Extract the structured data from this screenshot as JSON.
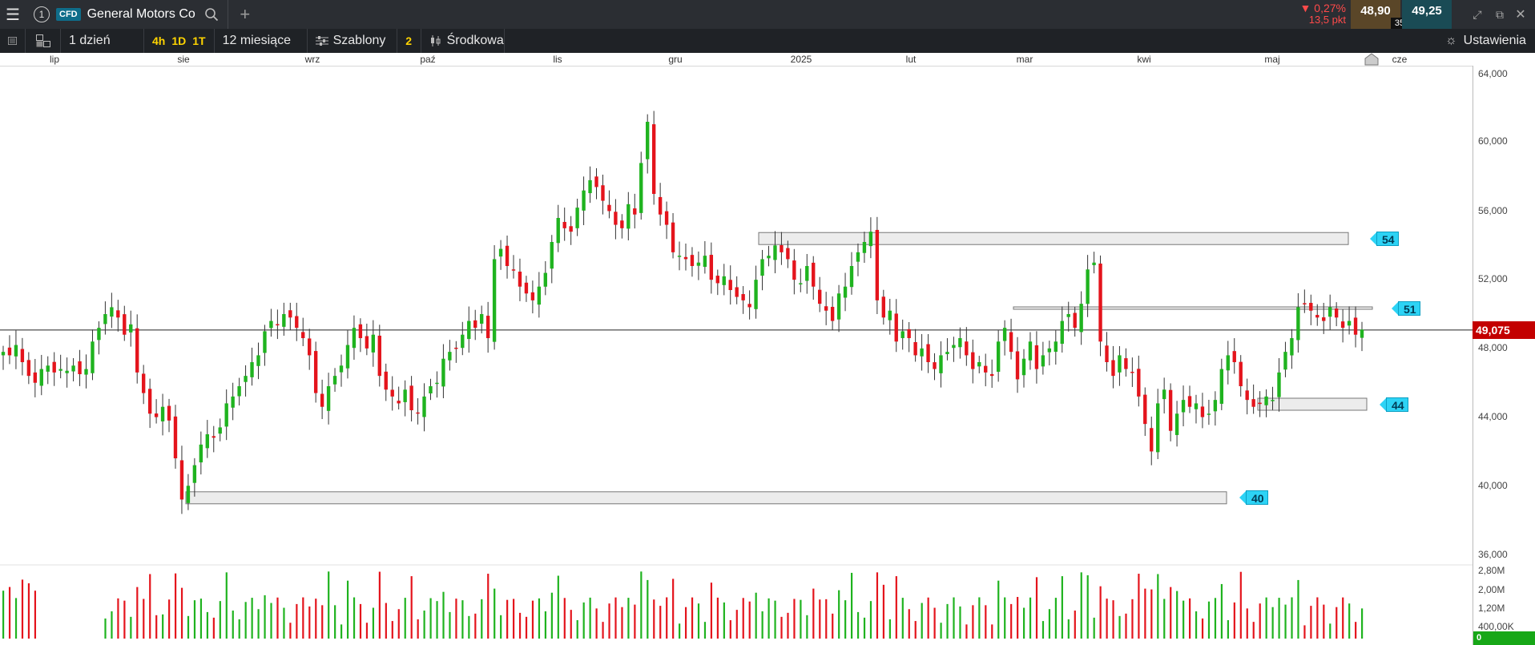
{
  "header": {
    "instrument_number": "1",
    "instrument_type": "CFD",
    "instrument_name": "General Motors Co",
    "change_pct": "▼ 0,27%",
    "change_pts": "13,5 pkt",
    "sell_price": "48,90",
    "spread": "35",
    "buy_price": "49,25"
  },
  "toolbar": {
    "interval": "1 dzień",
    "quick_intervals": [
      "4h",
      "1D",
      "1T"
    ],
    "range": "12 miesiące",
    "templates": "Szablony",
    "count": "2",
    "chart_type": "Środkowa",
    "settings": "Ustawienia"
  },
  "current_price": "49,075",
  "colors": {
    "up": "#1fb31f",
    "down": "#e4141c",
    "accent": "#2dd3f5",
    "price_tag": "#c30000"
  },
  "chart_data": {
    "type": "candlestick",
    "x_labels": [
      "lip",
      "sie",
      "wrz",
      "paź",
      "lis",
      "gru",
      "2025",
      "lut",
      "mar",
      "kwi",
      "maj",
      "cze"
    ],
    "y_ticks": [
      "64,000",
      "60,000",
      "56,000",
      "52,000",
      "48,000",
      "44,000",
      "40,000",
      "36,000"
    ],
    "ylim": [
      36,
      64
    ],
    "volume_ticks": [
      "2,80M",
      "2,00M",
      "1,20M",
      "400,00K",
      "0"
    ],
    "current_price": 49.075,
    "levels": [
      {
        "label": "54",
        "value": 54.4
      },
      {
        "label": "51",
        "value": 50.35
      },
      {
        "label": "44",
        "value": 44.75
      },
      {
        "label": "40",
        "value": 39.3
      }
    ],
    "closes": [
      47.8,
      47.6,
      48.2,
      47.2,
      46.4,
      46.0,
      46.8,
      47.0,
      46.6,
      46.8,
      46.7,
      47.0,
      46.5,
      46.8,
      48.4,
      49.2,
      50.0,
      50.4,
      49.8,
      48.8,
      49.4,
      46.6,
      45.4,
      44.2,
      44.0,
      44.6,
      43.8,
      41.6,
      39.2,
      40.0,
      41.2,
      42.4,
      43.0,
      42.8,
      43.4,
      44.8,
      45.2,
      45.8,
      46.4,
      47.2,
      47.6,
      49.0,
      49.6,
      49.4,
      50.0,
      49.8,
      49.2,
      48.6,
      47.6,
      45.4,
      44.6,
      45.8,
      46.4,
      47.0,
      48.2,
      49.2,
      48.6,
      48.0,
      48.8,
      46.4,
      45.6,
      45.2,
      44.8,
      45.6,
      44.4,
      44.2,
      45.2,
      45.8,
      46.0,
      47.4,
      47.8,
      48.0,
      48.8,
      49.6,
      49.2,
      50.0,
      48.6,
      53.2,
      53.8,
      52.8,
      52.6,
      51.6,
      51.2,
      50.8,
      51.6,
      52.4,
      54.2,
      55.6,
      55.0,
      54.8,
      56.2,
      57.2,
      57.8,
      57.4,
      56.6,
      56.0,
      55.2,
      55.0,
      56.4,
      55.8,
      58.8,
      61.2,
      57.0,
      55.8,
      55.2,
      53.6,
      53.4,
      53.2,
      52.8,
      53.0,
      53.4,
      52.0,
      51.8,
      52.2,
      51.4,
      51.0,
      50.8,
      50.4,
      52.0,
      53.2,
      53.4,
      54.0,
      53.6,
      53.2,
      52.0,
      51.8,
      52.8,
      51.6,
      50.6,
      50.2,
      49.6,
      51.2,
      51.6,
      52.8,
      53.6,
      54.2,
      54.8,
      50.8,
      49.8,
      50.2,
      48.4,
      49.0,
      48.6,
      47.6,
      48.0,
      47.2,
      46.8,
      47.6,
      47.8,
      48.2,
      48.6,
      47.6,
      46.8,
      47.2,
      46.6,
      46.4,
      48.4,
      49.2,
      47.8,
      46.2,
      47.4,
      48.4,
      46.8,
      47.6,
      48.0,
      48.4,
      49.6,
      50.0,
      49.2,
      50.6,
      52.6,
      53.0,
      48.4,
      47.2,
      46.4,
      47.6,
      46.8,
      46.6,
      45.2,
      43.6,
      42.0,
      44.8,
      45.6,
      43.2,
      44.2,
      45.0,
      44.6,
      44.8,
      44.0,
      44.2,
      45.0,
      46.8,
      47.6,
      47.2,
      45.8,
      45.0,
      44.6,
      44.8,
      45.2,
      45.0,
      46.6,
      47.8,
      48.6,
      50.4,
      50.6,
      50.2,
      49.8,
      49.6,
      50.4,
      49.8,
      49.2,
      49.6,
      48.8,
      49.1
    ],
    "volume_pct": [
      0.65,
      0.7,
      0.55,
      0.8,
      0.75,
      0.65,
      0,
      0,
      0,
      0,
      0,
      0,
      0,
      0,
      0,
      0,
      0,
      0,
      0,
      0,
      0,
      0,
      0,
      0,
      0,
      0,
      0,
      0,
      0,
      0,
      0,
      0,
      0,
      0,
      0,
      0,
      0,
      0,
      0,
      0,
      0,
      0,
      0,
      0,
      0,
      0,
      0,
      0,
      0,
      0,
      0,
      0,
      0,
      0,
      0,
      0,
      0,
      0,
      0,
      0,
      0,
      0,
      0,
      0,
      0,
      0,
      0,
      0,
      0,
      0,
      0,
      0,
      0,
      0,
      0,
      0,
      0,
      0,
      0,
      0,
      0,
      0,
      0,
      0,
      0,
      0,
      0,
      0,
      0,
      0,
      0,
      0,
      0,
      0,
      0,
      0,
      0,
      0,
      0,
      0,
      0,
      0,
      0,
      0,
      0,
      0,
      0,
      0,
      0,
      0,
      0,
      0,
      0,
      0,
      0,
      0,
      0,
      0,
      0,
      0,
      0,
      0,
      0,
      0,
      0,
      0,
      0,
      0,
      0,
      0,
      0,
      0,
      0,
      0,
      0,
      0,
      0,
      0,
      0,
      0,
      0,
      0,
      0,
      0,
      0,
      0,
      0,
      0,
      0,
      0,
      0,
      0,
      0,
      0,
      0,
      0,
      0,
      0,
      0,
      0,
      0,
      0,
      0,
      0,
      0,
      0,
      0,
      0,
      0,
      0,
      0,
      0,
      0,
      0,
      0,
      0,
      0,
      0,
      0,
      0,
      0,
      0,
      0,
      0,
      0,
      0,
      0,
      0,
      0,
      0,
      0,
      0,
      0,
      0,
      0,
      0,
      0,
      0,
      0,
      0,
      0,
      0,
      0,
      0,
      0,
      0,
      0,
      0,
      0,
      0,
      0,
      0,
      0,
      0,
      0,
      0,
      0,
      0
    ]
  }
}
